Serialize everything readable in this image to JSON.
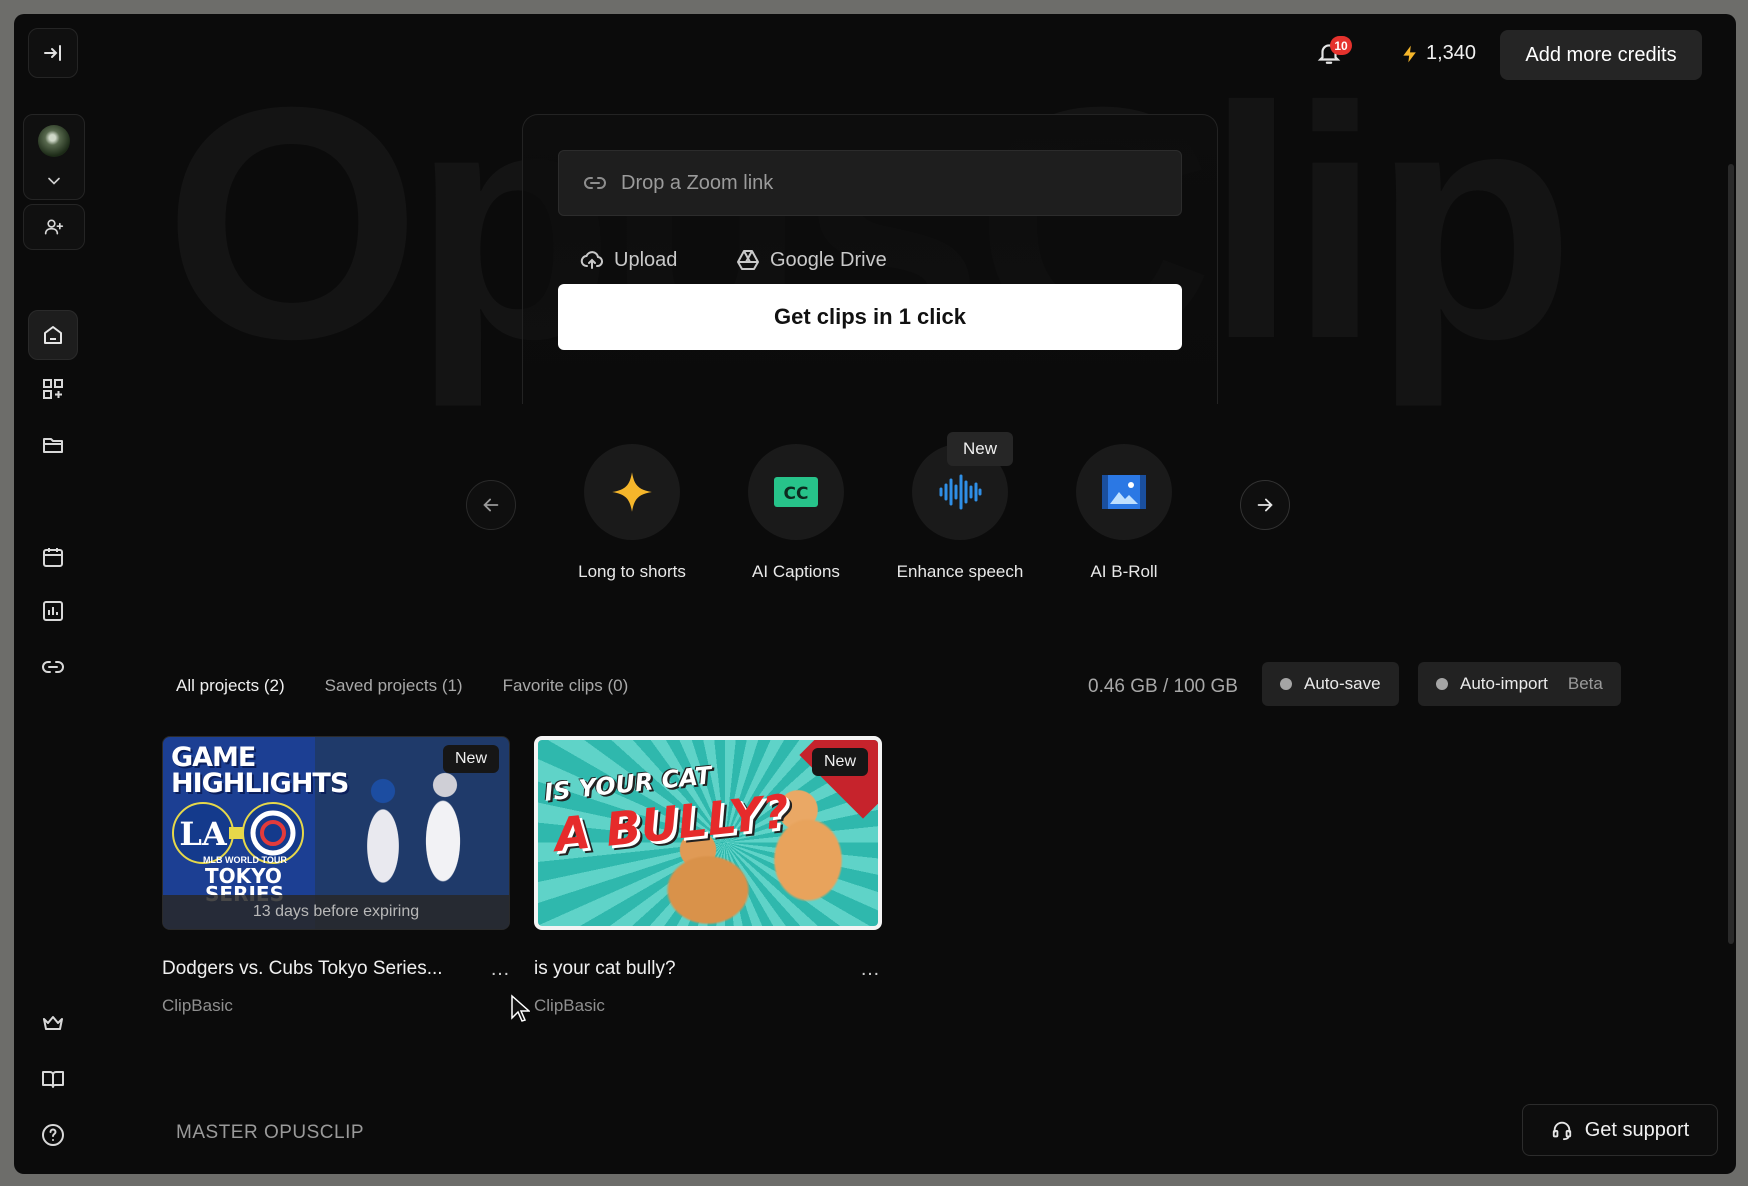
{
  "brand_watermark": "OpusClip",
  "topbar": {
    "notification_count": "10",
    "credits": "1,340",
    "add_credits_label": "Add more credits"
  },
  "sidebar": {
    "items": [
      "collapse",
      "home",
      "create",
      "projects",
      "calendar",
      "analytics",
      "links",
      "plans",
      "tutorials",
      "help"
    ]
  },
  "upload": {
    "link_placeholder": "Drop a Zoom link",
    "upload_label": "Upload",
    "drive_label": "Google Drive",
    "cta_label": "Get clips in 1 click"
  },
  "tools": [
    {
      "label": "Long to shorts",
      "icon": "sparkle-icon"
    },
    {
      "label": "AI Captions",
      "icon": "cc-icon"
    },
    {
      "label": "Enhance speech",
      "icon": "waveform-icon",
      "badge": "New"
    },
    {
      "label": "AI B-Roll",
      "icon": "image-film-icon"
    }
  ],
  "projects": {
    "tabs": [
      "All projects (2)",
      "Saved projects (1)",
      "Favorite clips (0)"
    ],
    "storage": "0.46 GB / 100 GB",
    "auto_save_label": "Auto-save",
    "auto_import_label": "Auto-import",
    "beta_label": "Beta",
    "items": [
      {
        "title": "Dodgers vs. Cubs Tokyo Series...",
        "subtitle": "ClipBasic",
        "badge": "New",
        "expire_note": "13 days before expiring",
        "thumb_headline": "GAME HIGHLIGHTS",
        "thumb_footer": "TOKYO SERIES",
        "thumb_caption": "MLB WORLD TOUR"
      },
      {
        "title": "is your cat bully?",
        "subtitle": "ClipBasic",
        "badge": "New",
        "thumb_line1": "IS YOUR CAT",
        "thumb_line2": "A BULLY?"
      }
    ]
  },
  "section_title": "MASTER OPUSCLIP",
  "support_label": "Get support",
  "colors": {
    "background": "#0b0b0b",
    "accent_yellow": "#f5b62b",
    "badge_red": "#e5322d",
    "captions_green": "#27c38a",
    "speech_blue": "#2f8fe6"
  }
}
